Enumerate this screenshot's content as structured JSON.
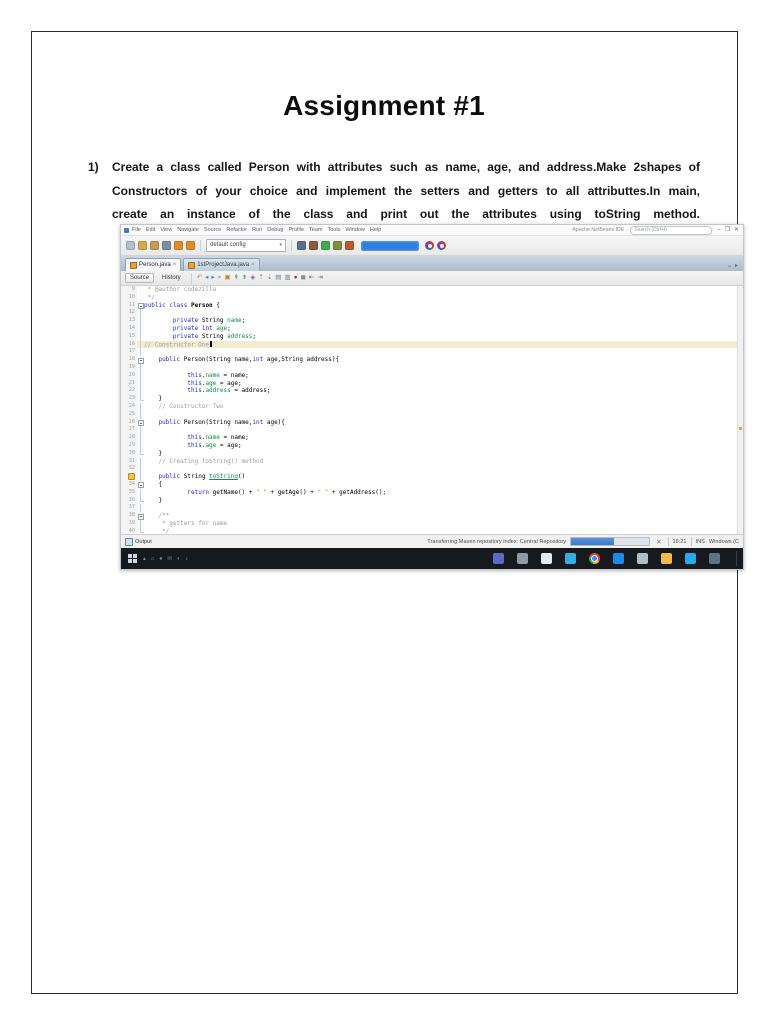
{
  "document": {
    "page_title": "Assignment #1",
    "question": {
      "number": "1)",
      "text": "Create a class called Person with attributes such as name, age, and address.Make 2shapes of\nConstructors of your choice and implement the setters and getters to all attributtes.In main,\ncreate an instance of the class and print out the attributes using toString method."
    }
  },
  "ide": {
    "titlebar": {
      "window_title": "Apache NetBeans IDE",
      "search_placeholder": "Search (Ctrl+I)",
      "controls": [
        {
          "name": "minimize-icon",
          "glyph": "–"
        },
        {
          "name": "maximize-icon",
          "glyph": "❐"
        },
        {
          "name": "close-icon",
          "glyph": "✕"
        }
      ]
    },
    "menu_items": [
      "File",
      "Edit",
      "View",
      "Navigate",
      "Source",
      "Refactor",
      "Run",
      "Debug",
      "Profile",
      "Team",
      "Tools",
      "Window",
      "Help"
    ],
    "toolbar": {
      "left_icons": [
        {
          "name": "new-file-icon",
          "color": "#aebfcd"
        },
        {
          "name": "new-project-icon",
          "color": "#d8a84e"
        },
        {
          "name": "open-project-icon",
          "color": "#c59a52"
        },
        {
          "name": "save-all-icon",
          "color": "#7b8fa3"
        },
        {
          "name": "undo-icon",
          "color": "#e08a2e"
        },
        {
          "name": "redo-icon",
          "color": "#e08a2e"
        }
      ],
      "config_value": "default config",
      "right_icons": [
        {
          "name": "build-project-icon",
          "color": "#5b6f84"
        },
        {
          "name": "clean-build-icon",
          "color": "#8a5a3c"
        },
        {
          "name": "run-project-icon",
          "color": "#3fae4a"
        },
        {
          "name": "debug-project-icon",
          "color": "#7f8c42"
        },
        {
          "name": "profile-project-icon",
          "color": "#c2572e"
        }
      ],
      "badge_color": "#2f7fe0",
      "ring_icons": [
        {
          "name": "update-center-icon"
        },
        {
          "name": "report-issue-icon"
        }
      ]
    },
    "tabs": [
      {
        "label": "Person.java",
        "active": true
      },
      {
        "label": "1stProjectJava.java",
        "active": false
      }
    ],
    "editor_toolbar": {
      "source_label": "Source",
      "history_label": "History",
      "icons": [
        {
          "name": "last-edit-icon",
          "glyph": "↶",
          "color": "#c07a2e"
        },
        {
          "name": "back-icon",
          "glyph": "◂",
          "color": "#3f7fc4"
        },
        {
          "name": "forward-icon",
          "glyph": "▸",
          "color": "#3f7fc4"
        },
        {
          "name": "find-selection-icon",
          "glyph": "⌕",
          "color": "#4a6c8e"
        },
        {
          "name": "highlight-icon",
          "glyph": "▣",
          "color": "#b08a2e"
        },
        {
          "name": "prev-bookmark-icon",
          "glyph": "⇞",
          "color": "#4a9c58"
        },
        {
          "name": "next-bookmark-icon",
          "glyph": "⇟",
          "color": "#4a9c58"
        },
        {
          "name": "toggle-bookmark-icon",
          "glyph": "◈",
          "color": "#7a5fb0"
        },
        {
          "name": "prev-usage-icon",
          "glyph": "⇡",
          "color": "#c0572e"
        },
        {
          "name": "next-usage-icon",
          "glyph": "⇣",
          "color": "#c0572e"
        },
        {
          "name": "comment-icon",
          "glyph": "▤",
          "color": "#6b7b8d"
        },
        {
          "name": "uncomment-icon",
          "glyph": "▥",
          "color": "#6b7b8d"
        },
        {
          "name": "record-macro-icon",
          "glyph": "●",
          "color": "#b0352f"
        },
        {
          "name": "stop-macro-icon",
          "glyph": "◼",
          "color": "#8a8f94"
        },
        {
          "name": "shift-left-icon",
          "glyph": "⇤",
          "color": "#55707d"
        },
        {
          "name": "shift-right-icon",
          "glyph": "⇥",
          "color": "#55707d"
        }
      ]
    },
    "editor": {
      "lines": [
        {
          "n": 9,
          "t": [
            [
              "c",
              " * @author codezilla"
            ]
          ]
        },
        {
          "n": 10,
          "t": [
            [
              "c",
              " */"
            ]
          ]
        },
        {
          "n": 11,
          "fold": "start",
          "t": [
            [
              "k",
              "public"
            ],
            [
              "p",
              " "
            ],
            [
              "k",
              "class"
            ],
            [
              "p",
              " "
            ],
            [
              "b",
              "Person"
            ],
            [
              "p",
              " {"
            ]
          ]
        },
        {
          "n": 12,
          "fold": "line",
          "t": []
        },
        {
          "n": 13,
          "fold": "line",
          "t": [
            [
              "p",
              "        "
            ],
            [
              "k",
              "private"
            ],
            [
              "p",
              " String "
            ],
            [
              "f",
              "name"
            ],
            [
              "p",
              ";"
            ]
          ]
        },
        {
          "n": 14,
          "fold": "line",
          "t": [
            [
              "p",
              "        "
            ],
            [
              "k",
              "private"
            ],
            [
              "p",
              " "
            ],
            [
              "k",
              "int"
            ],
            [
              "p",
              " "
            ],
            [
              "f",
              "age"
            ],
            [
              "p",
              ";"
            ]
          ]
        },
        {
          "n": 15,
          "fold": "line",
          "t": [
            [
              "p",
              "        "
            ],
            [
              "k",
              "private"
            ],
            [
              "p",
              " String "
            ],
            [
              "f",
              "address"
            ],
            [
              "p",
              ";"
            ]
          ]
        },
        {
          "n": 16,
          "fold": "line",
          "hl": true,
          "caret": true,
          "t": [
            [
              "c",
              "// Constructor One"
            ]
          ]
        },
        {
          "n": 17,
          "fold": "line",
          "t": []
        },
        {
          "n": 18,
          "fold": "start",
          "t": [
            [
              "p",
              "    "
            ],
            [
              "k",
              "public"
            ],
            [
              "p",
              " Person(String name,"
            ],
            [
              "k",
              "int"
            ],
            [
              "p",
              " age,String address){"
            ]
          ]
        },
        {
          "n": 19,
          "fold": "line",
          "t": []
        },
        {
          "n": 20,
          "fold": "line",
          "t": [
            [
              "p",
              "            "
            ],
            [
              "k",
              "this"
            ],
            [
              "p",
              "."
            ],
            [
              "f",
              "name"
            ],
            [
              "p",
              " = name;"
            ]
          ]
        },
        {
          "n": 21,
          "fold": "line",
          "t": [
            [
              "p",
              "            "
            ],
            [
              "k",
              "this"
            ],
            [
              "p",
              "."
            ],
            [
              "f",
              "age"
            ],
            [
              "p",
              " = age;"
            ]
          ]
        },
        {
          "n": 22,
          "fold": "line",
          "t": [
            [
              "p",
              "            "
            ],
            [
              "k",
              "this"
            ],
            [
              "p",
              "."
            ],
            [
              "f",
              "address"
            ],
            [
              "p",
              " = address;"
            ]
          ]
        },
        {
          "n": 23,
          "fold": "end",
          "t": [
            [
              "p",
              "    }"
            ]
          ]
        },
        {
          "n": 24,
          "fold": "line",
          "t": [
            [
              "p",
              "    "
            ],
            [
              "c",
              "// Constructor Two"
            ]
          ]
        },
        {
          "n": 25,
          "fold": "line",
          "t": []
        },
        {
          "n": 26,
          "fold": "start",
          "t": [
            [
              "p",
              "    "
            ],
            [
              "k",
              "public"
            ],
            [
              "p",
              " Person(String name,"
            ],
            [
              "k",
              "int"
            ],
            [
              "p",
              " age){"
            ]
          ]
        },
        {
          "n": 27,
          "fold": "line",
          "t": []
        },
        {
          "n": 28,
          "fold": "line",
          "t": [
            [
              "p",
              "            "
            ],
            [
              "k",
              "this"
            ],
            [
              "p",
              "."
            ],
            [
              "f",
              "name"
            ],
            [
              "p",
              " = name;"
            ]
          ]
        },
        {
          "n": 29,
          "fold": "line",
          "t": [
            [
              "p",
              "            "
            ],
            [
              "k",
              "this"
            ],
            [
              "p",
              "."
            ],
            [
              "f",
              "age"
            ],
            [
              "p",
              " = age;"
            ]
          ]
        },
        {
          "n": 30,
          "fold": "end",
          "t": [
            [
              "p",
              "    }"
            ]
          ]
        },
        {
          "n": 31,
          "fold": "line",
          "t": [
            [
              "p",
              "    "
            ],
            [
              "c",
              "// Creating toString() method"
            ]
          ]
        },
        {
          "n": 32,
          "fold": "line",
          "t": []
        },
        {
          "n": 33,
          "fold": "line",
          "bulb": true,
          "t": [
            [
              "p",
              "    "
            ],
            [
              "k",
              "public"
            ],
            [
              "p",
              " String "
            ],
            [
              "u",
              "toString"
            ],
            [
              "p",
              "()"
            ]
          ]
        },
        {
          "n": 34,
          "fold": "start",
          "t": [
            [
              "p",
              "    {"
            ]
          ]
        },
        {
          "n": 35,
          "fold": "line",
          "t": [
            [
              "p",
              "            "
            ],
            [
              "k",
              "return"
            ],
            [
              "p",
              " getName() + "
            ],
            [
              "s",
              "\" \""
            ],
            [
              "p",
              " + getAge() + "
            ],
            [
              "s",
              "\" \""
            ],
            [
              "p",
              " + getAddress();"
            ]
          ]
        },
        {
          "n": 36,
          "fold": "end",
          "t": [
            [
              "p",
              "    }"
            ]
          ]
        },
        {
          "n": 37,
          "fold": "line",
          "t": []
        },
        {
          "n": 38,
          "fold": "start",
          "t": [
            [
              "p",
              "    "
            ],
            [
              "c",
              "/**"
            ]
          ]
        },
        {
          "n": 39,
          "fold": "line",
          "t": [
            [
              "p",
              "    "
            ],
            [
              "c",
              " * getters for name"
            ]
          ]
        },
        {
          "n": 40,
          "fold": "end",
          "t": [
            [
              "p",
              "    "
            ],
            [
              "c",
              " */"
            ]
          ]
        }
      ]
    },
    "output_label": "Output",
    "status": {
      "message": "Transferring Maven repository index: Central Repository",
      "progress_percent": 55,
      "close_glyph": "✕",
      "caret_position": "16:21",
      "insert_mode": "INS",
      "trailing": "Windows (C"
    },
    "taskbar": {
      "tray_glyphs": [
        "▴",
        "⌂",
        "●",
        "✉",
        "◐",
        "♪"
      ],
      "apps": [
        {
          "name": "teams-app-icon",
          "color": "#5c6bc0"
        },
        {
          "name": "file-explorer-icon",
          "color": "#8d9aa5"
        },
        {
          "name": "settings-app-icon",
          "color": "#e8ebee"
        },
        {
          "name": "telegram-app-icon",
          "color": "#35ade3"
        },
        {
          "name": "chrome-browser-icon",
          "color": "chrome"
        },
        {
          "name": "mail-app-icon",
          "color": "#1e88e5"
        },
        {
          "name": "recycle-bin-icon",
          "color": "#aebdc6"
        },
        {
          "name": "folder-app-icon",
          "color": "#f2b84b"
        },
        {
          "name": "skype-app-icon",
          "color": "#28a8ea"
        },
        {
          "name": "store-app-icon",
          "color": "#5f7482"
        }
      ]
    }
  }
}
